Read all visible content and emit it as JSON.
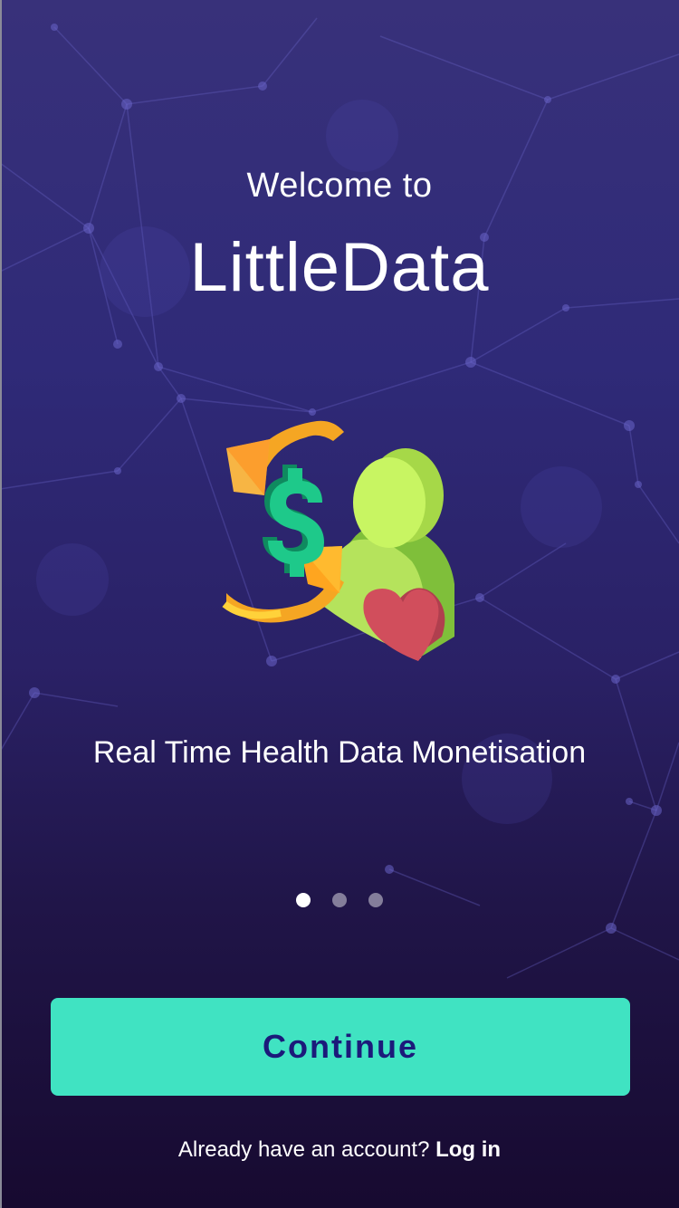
{
  "onboarding": {
    "welcome_text": "Welcome to",
    "app_name": "LittleData",
    "tagline": "Real Time Health Data Monetisation",
    "hero_icon": "money-exchange-user-heart-illustration",
    "pagination": {
      "total": 3,
      "active_index": 0
    },
    "continue_label": "Continue",
    "login_prompt": "Already have an account? ",
    "login_link": "Log in"
  },
  "colors": {
    "background_top": "#38317a",
    "background_bottom": "#170a30",
    "button": "#40e3c2",
    "button_text": "#1b1a7a",
    "dot_active": "#ffffff",
    "dot_inactive": "#8f8aa8"
  }
}
